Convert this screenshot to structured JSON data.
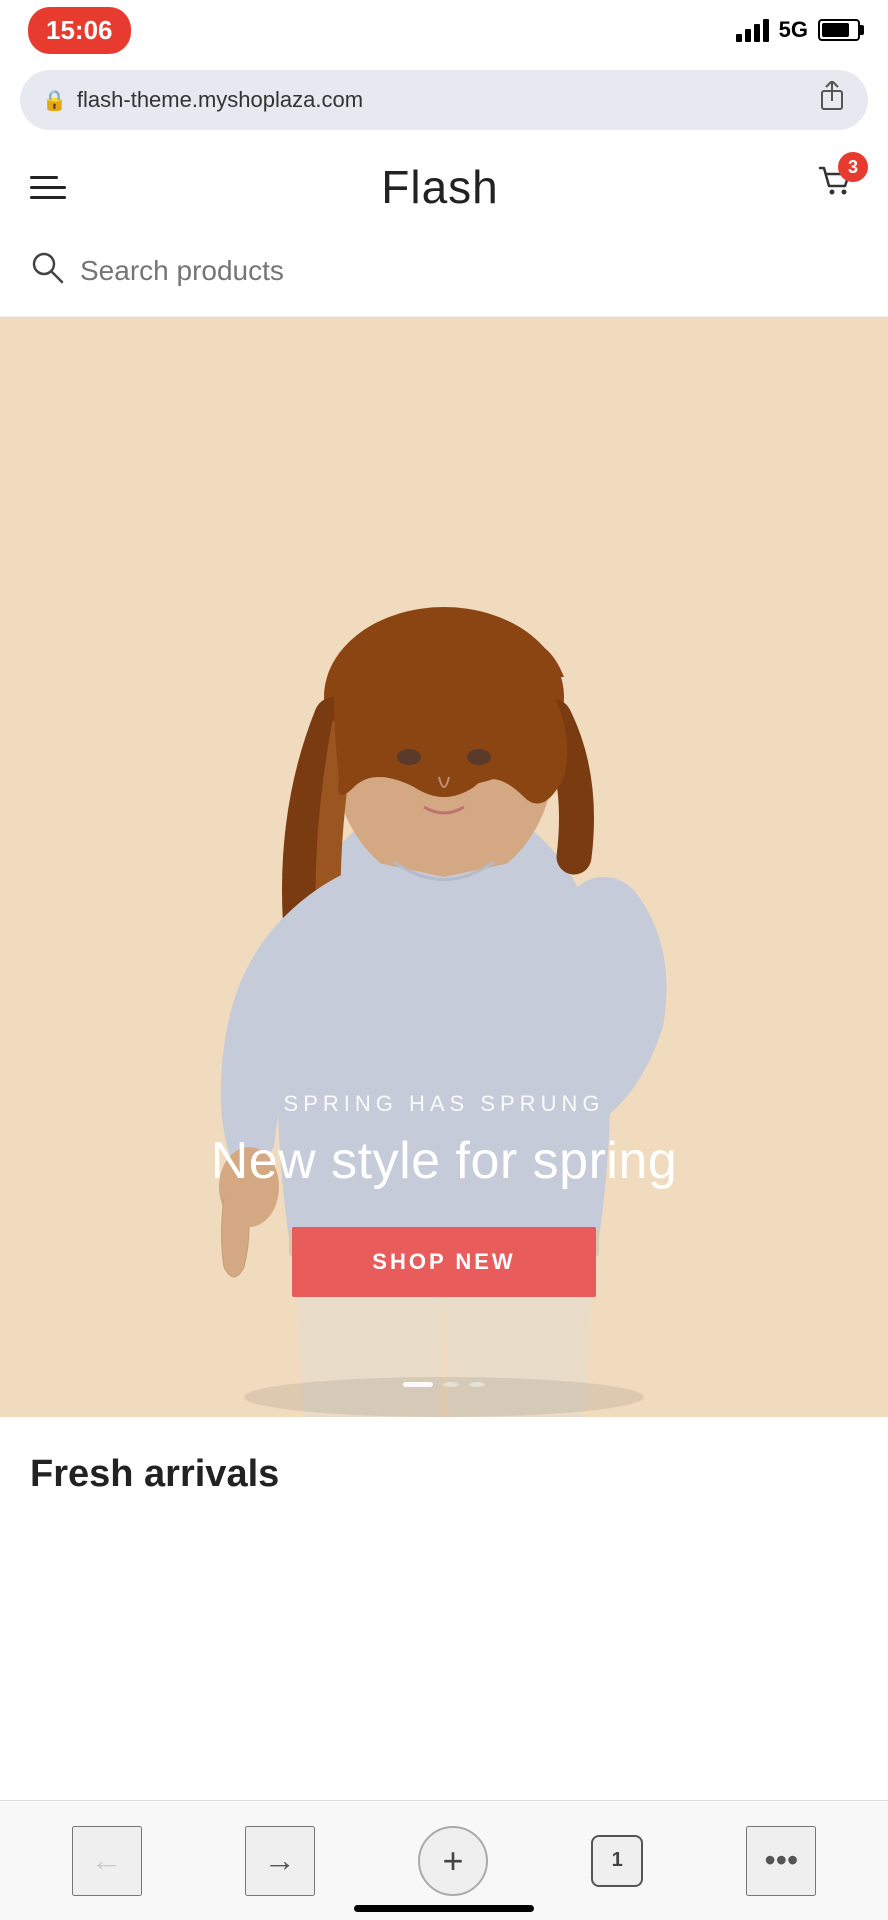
{
  "status": {
    "time": "15:06",
    "network": "5G"
  },
  "url_bar": {
    "url": "flash-theme.myshoplaza.com",
    "secure": true
  },
  "header": {
    "title": "Flash",
    "cart_count": "3"
  },
  "search": {
    "placeholder": "Search products"
  },
  "hero": {
    "subtitle": "SPRING HAS SPRUNG",
    "title": "New style for spring",
    "button_label": "SHOP NEW",
    "bg_color": "#f0dbbf"
  },
  "sections": [
    {
      "title": "Fresh arrivals"
    }
  ],
  "browser_bar": {
    "back": "←",
    "forward": "→",
    "add": "+",
    "tabs": "1",
    "more": "•••"
  }
}
